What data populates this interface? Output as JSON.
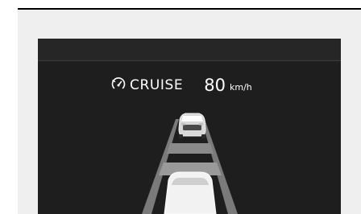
{
  "cruise": {
    "icon": "speedometer-icon",
    "label": "CRUISE",
    "speed_value": "80",
    "speed_unit": "km/h"
  }
}
